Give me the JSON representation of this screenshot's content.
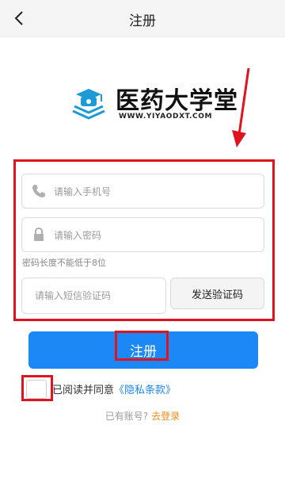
{
  "header": {
    "title": "注册"
  },
  "brand": {
    "name_cn": "医药大学堂",
    "name_en": "WWW.YIYAODXT.COM"
  },
  "form": {
    "phone_placeholder": "请输入手机号",
    "password_placeholder": "请输入密码",
    "password_hint": "密码长度不能低于8位",
    "code_placeholder": "请输入短信验证码",
    "send_code_label": "发送验证码",
    "submit_label": "注册"
  },
  "agreement": {
    "checked": false,
    "prefix": "已阅读并同意",
    "link": "《隐私条款》"
  },
  "login": {
    "prompt": "已有账号?",
    "link": "去登录"
  },
  "colors": {
    "accent": "#1b88f5",
    "annotation": "#e0141e",
    "link_orange": "#f08a1e"
  },
  "icons": [
    "chevron-left-icon",
    "phone-icon",
    "lock-icon",
    "logo-book-icon",
    "arrow-down-icon"
  ]
}
